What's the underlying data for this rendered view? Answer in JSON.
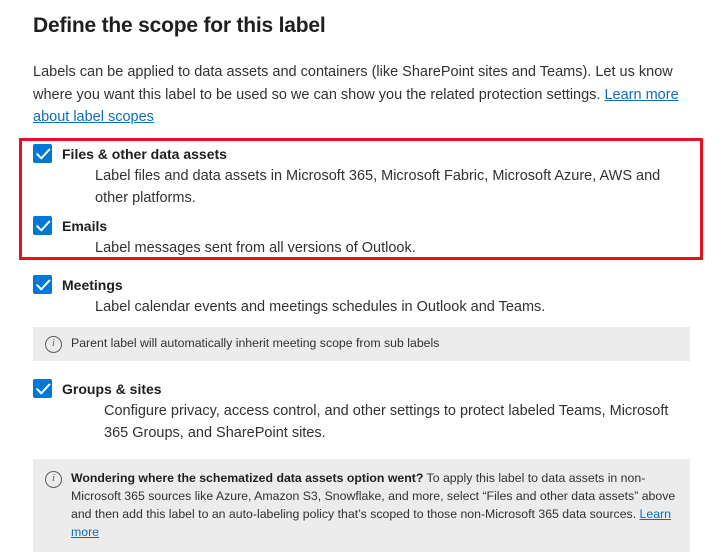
{
  "page": {
    "title": "Define the scope for this label",
    "intro_text": "Labels can be applied to data assets and containers (like SharePoint sites and Teams). Let us know where you want this label to be used so we can show you the related protection settings. ",
    "intro_link": "Learn more about label scopes"
  },
  "scopes": [
    {
      "id": "files-other-data-assets",
      "label": "Files & other data assets",
      "description": "Label files and data assets in Microsoft 365, Microsoft Fabric, Microsoft Azure, AWS and other platforms.",
      "checked": true
    },
    {
      "id": "emails",
      "label": "Emails",
      "description": "Label messages sent from all versions of Outlook.",
      "checked": true
    },
    {
      "id": "meetings",
      "label": "Meetings",
      "description": "Label calendar events and meetings schedules in Outlook and Teams.",
      "checked": true
    },
    {
      "id": "groups-sites",
      "label": "Groups & sites",
      "description": "Configure privacy, access control, and other settings to protect labeled Teams, Microsoft 365 Groups, and SharePoint sites.",
      "checked": true
    }
  ],
  "meetings_info": {
    "text": "Parent label will automatically inherit meeting scope from sub labels"
  },
  "bottom_info": {
    "bold_lead": "Wondering where the schematized data assets option went?",
    "body": " To apply this label to data assets in non-Microsoft 365 sources like Azure, Amazon S3, Snowflake, and more, select “Files and other data assets” above and then add this label to an auto-labeling policy that’s scoped to those non-Microsoft 365 data sources. ",
    "link": "Learn more"
  },
  "colors": {
    "accent": "#0078d4",
    "link": "#0f6cbd",
    "highlight_border": "#e81123",
    "info_background": "#ececec",
    "text": "#323130"
  },
  "annotation": {
    "highlight_label": "red-highlight-box"
  }
}
